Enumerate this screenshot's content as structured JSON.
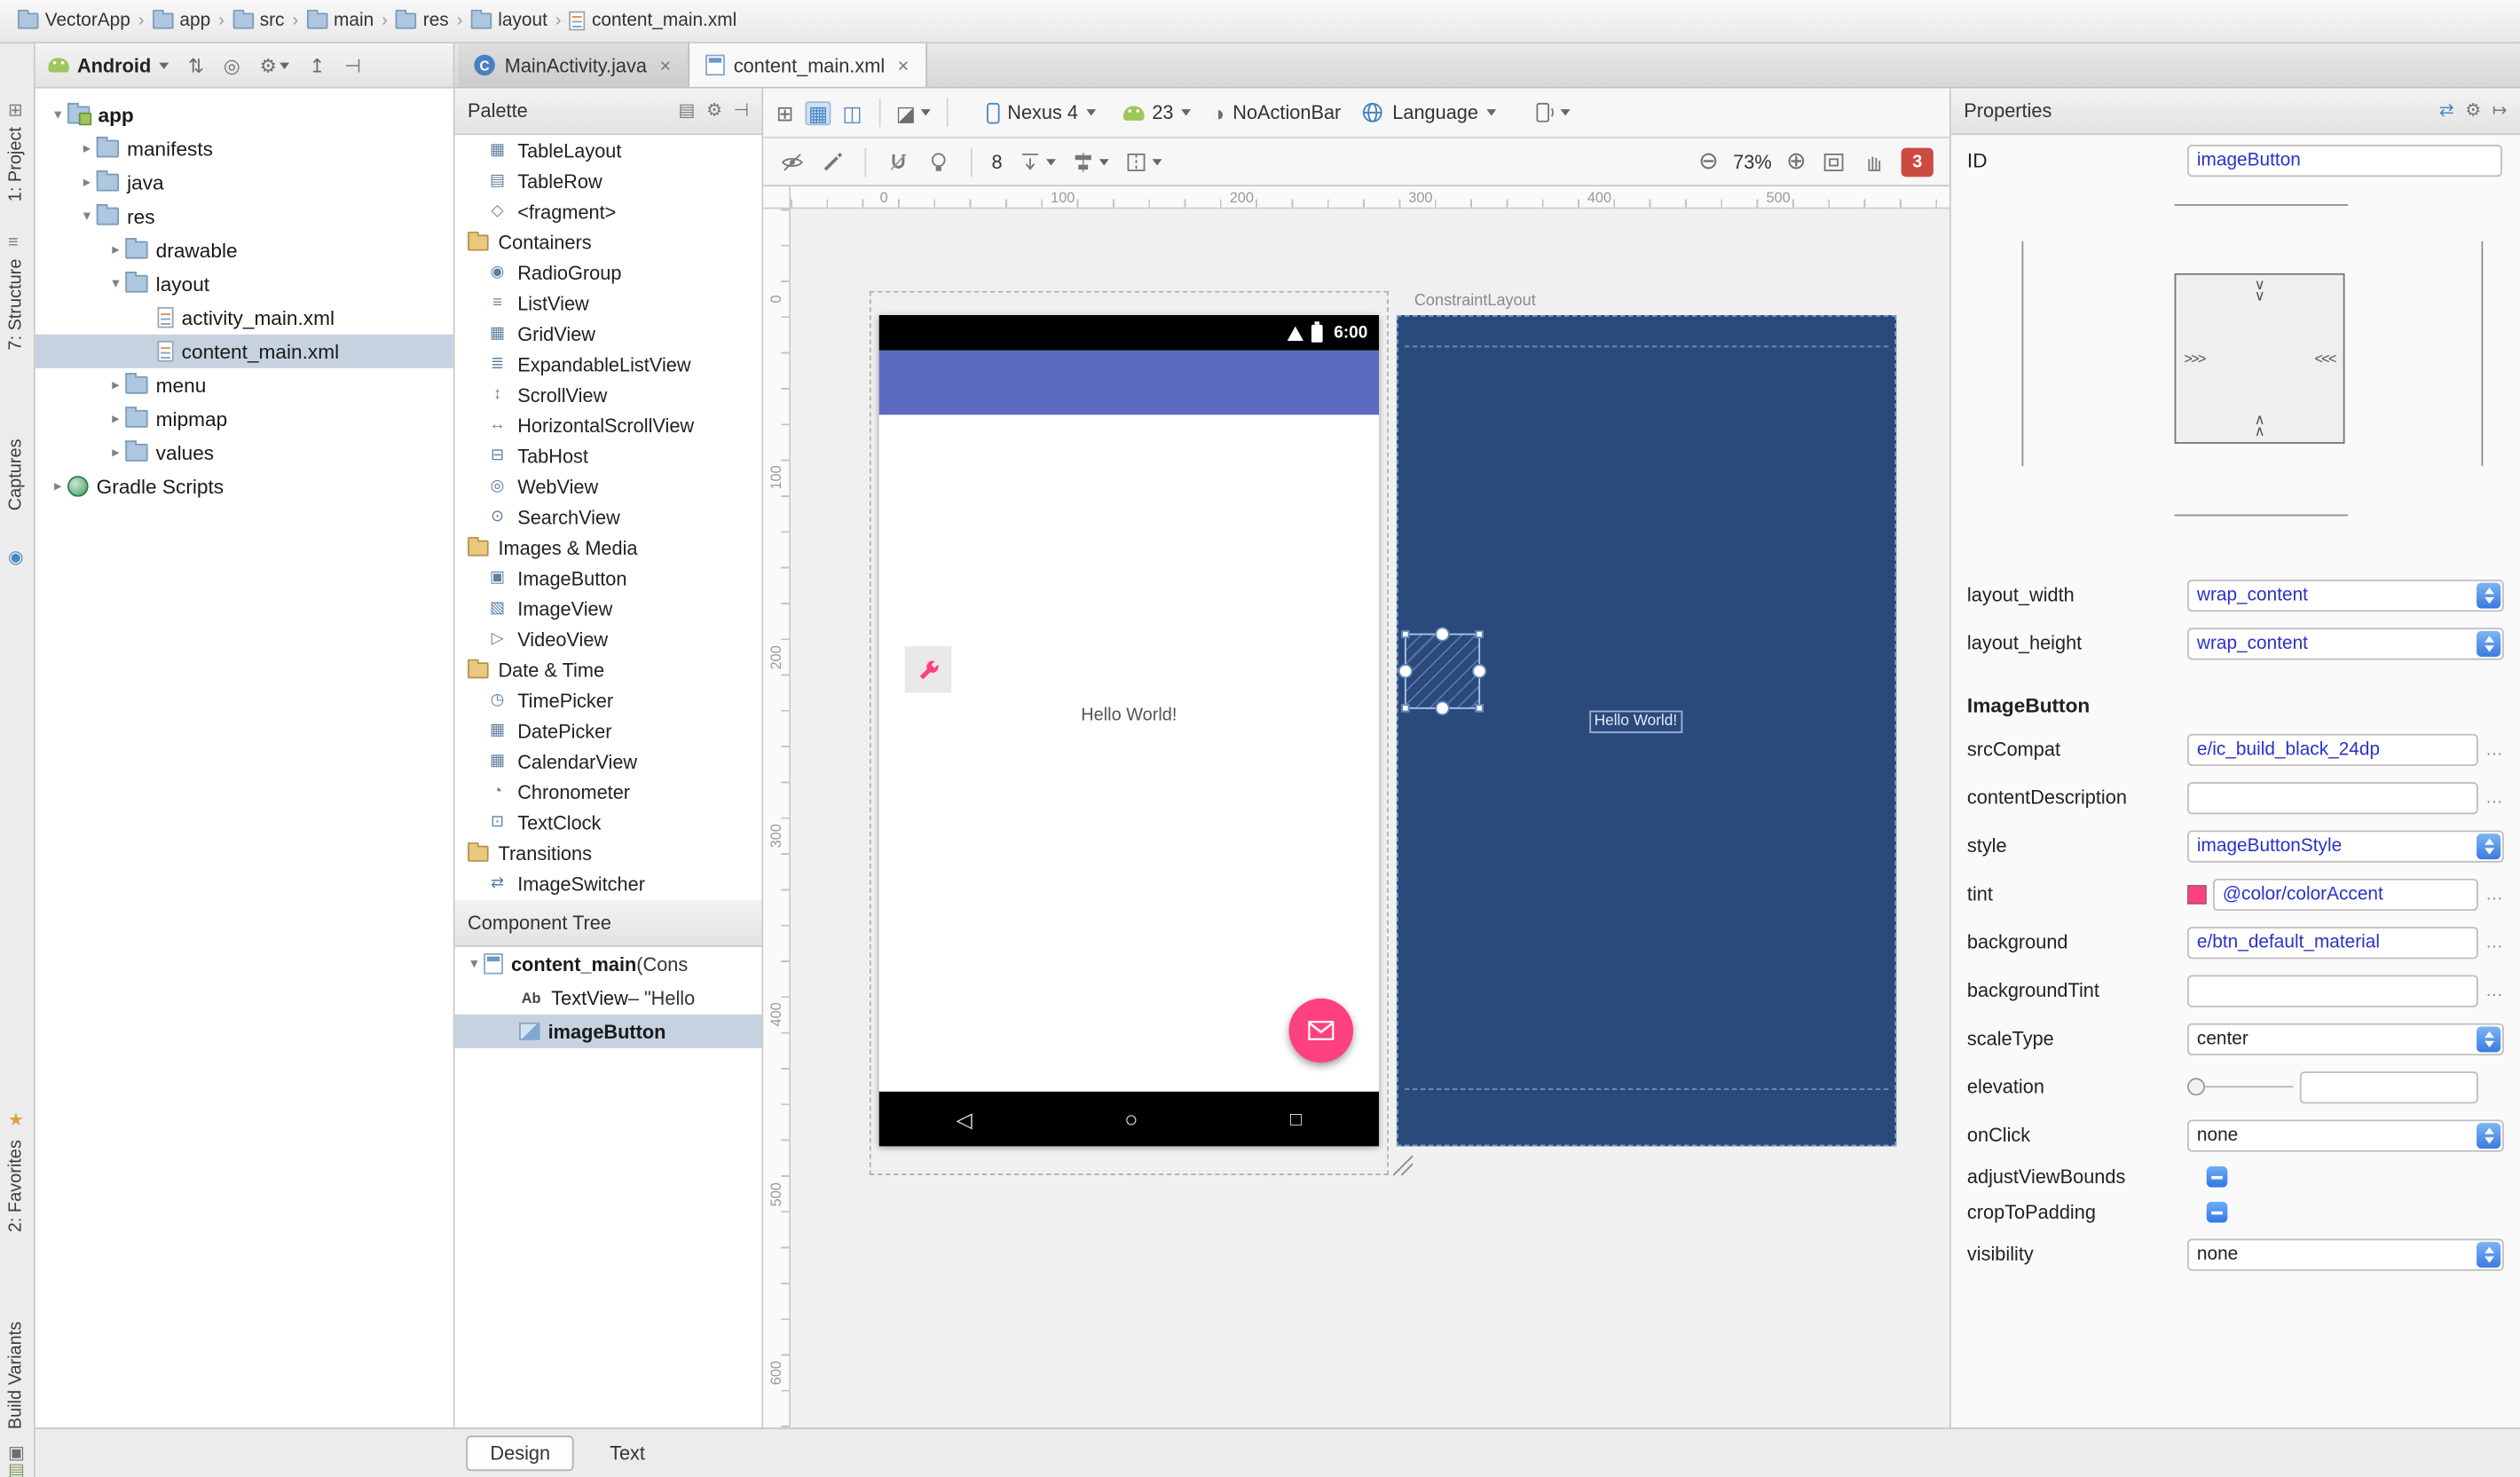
{
  "icons": {
    "crumb_sep": "›",
    "tree_expanded": "▾",
    "tree_collapsed": "▸",
    "close": "×",
    "class_c": "C",
    "ab": "Ab",
    "nav_back": "◁",
    "nav_home": "○",
    "nav_recents": "□",
    "zoom_out": "⊖",
    "zoom_in": "⊕",
    "gear": "⚙",
    "swap": "⇄",
    "pin": "↦",
    "more": "…",
    "grid1": "⊞",
    "grid2": "▦",
    "grid3": "◫",
    "paint": "◪",
    "theme_half": "◑",
    "palette_view": "▤",
    "palette_pin": "⊣",
    "proj_nav": "⇅",
    "proj_locate": "◎",
    "proj_collapse": "↥",
    "proj_pin": "⊣",
    "strip_project": "⊞",
    "strip_structure": "≡",
    "strip_captures": "◉",
    "strip_star": "★",
    "strip_variants": "▤",
    "toggle_toolwindows": "▣"
  },
  "breadcrumb": {
    "items": [
      "VectorApp",
      "app",
      "src",
      "main",
      "res",
      "layout",
      "content_main.xml"
    ]
  },
  "left_strip": {
    "top": [
      {
        "label": "1: Project",
        "icon": "strip_project"
      },
      {
        "label": "7: Structure",
        "icon": "strip_structure"
      },
      {
        "label": "Captures",
        "icon": "strip_captures"
      }
    ],
    "bottom": [
      {
        "label": "2: Favorites",
        "icon": "strip_star"
      },
      {
        "label": "Build Variants",
        "icon": "strip_variants"
      }
    ]
  },
  "project_toolbar": {
    "view": "Android"
  },
  "editor_tabs": [
    {
      "label": "MainActivity.java"
    },
    {
      "label": "content_main.xml"
    }
  ],
  "project_tree": {
    "items": [
      {
        "label": "app",
        "depth": 0,
        "icon": "folder-app",
        "arrow": "down",
        "bold": true
      },
      {
        "label": "manifests",
        "depth": 1,
        "icon": "folder",
        "arrow": "right"
      },
      {
        "label": "java",
        "depth": 1,
        "icon": "folder",
        "arrow": "right"
      },
      {
        "label": "res",
        "depth": 1,
        "icon": "folder-res",
        "arrow": "down"
      },
      {
        "label": "drawable",
        "depth": 2,
        "icon": "folder",
        "arrow": "right"
      },
      {
        "label": "layout",
        "depth": 2,
        "icon": "folder",
        "arrow": "down"
      },
      {
        "label": "activity_main.xml",
        "depth": 3,
        "icon": "file-xml",
        "arrow": "none"
      },
      {
        "label": "content_main.xml",
        "depth": 3,
        "icon": "file-xml",
        "arrow": "none",
        "selected": true
      },
      {
        "label": "menu",
        "depth": 2,
        "icon": "folder",
        "arrow": "right"
      },
      {
        "label": "mipmap",
        "depth": 2,
        "icon": "folder",
        "arrow": "right"
      },
      {
        "label": "values",
        "depth": 2,
        "icon": "folder",
        "arrow": "right"
      },
      {
        "label": "Gradle Scripts",
        "depth": 0,
        "icon": "gradle",
        "arrow": "right"
      }
    ]
  },
  "palette": {
    "title": "Palette",
    "items": [
      {
        "t": "item",
        "label": "TableLayout",
        "g": "▦"
      },
      {
        "t": "item",
        "label": "TableRow",
        "g": "▤"
      },
      {
        "t": "item",
        "label": "<fragment>",
        "g": "◇"
      },
      {
        "t": "header",
        "label": "Containers"
      },
      {
        "t": "item",
        "label": "RadioGroup",
        "g": "◉"
      },
      {
        "t": "item",
        "label": "ListView",
        "g": "≡"
      },
      {
        "t": "item",
        "label": "GridView",
        "g": "▦"
      },
      {
        "t": "item",
        "label": "ExpandableListView",
        "g": "≣"
      },
      {
        "t": "item",
        "label": "ScrollView",
        "g": "↕"
      },
      {
        "t": "item",
        "label": "HorizontalScrollView",
        "g": "↔"
      },
      {
        "t": "item",
        "label": "TabHost",
        "g": "⊟"
      },
      {
        "t": "item",
        "label": "WebView",
        "g": "◎"
      },
      {
        "t": "item",
        "label": "SearchView",
        "g": "⊙"
      },
      {
        "t": "header",
        "label": "Images & Media"
      },
      {
        "t": "item",
        "label": "ImageButton",
        "g": "▣"
      },
      {
        "t": "item",
        "label": "ImageView",
        "g": "▧"
      },
      {
        "t": "item",
        "label": "VideoView",
        "g": "▷"
      },
      {
        "t": "header",
        "label": "Date & Time"
      },
      {
        "t": "item",
        "label": "TimePicker",
        "g": "◷"
      },
      {
        "t": "item",
        "label": "DatePicker",
        "g": "▦"
      },
      {
        "t": "item",
        "label": "CalendarView",
        "g": "▦"
      },
      {
        "t": "item",
        "label": "Chronometer",
        "g": "◔"
      },
      {
        "t": "item",
        "label": "TextClock",
        "g": "⊡"
      },
      {
        "t": "header",
        "label": "Transitions"
      },
      {
        "t": "item",
        "label": "ImageSwitcher",
        "g": "⇄"
      }
    ]
  },
  "component_tree": {
    "title": "Component Tree",
    "items": [
      {
        "name": "content_main",
        "suffix": " (Cons",
        "icon": "layout",
        "selected": false
      },
      {
        "name": "TextView",
        "suffix": " – \"Hello",
        "icon": "ab",
        "selected": false
      },
      {
        "name": "imageButton",
        "suffix": "",
        "icon": "image",
        "selected": true
      }
    ]
  },
  "design_toolbar": {
    "device": "Nexus 4",
    "api": "23",
    "theme": "NoActionBar",
    "language": "Language"
  },
  "zoom_toolbar": {
    "margin": "8",
    "zoom": "73%",
    "errors": "3"
  },
  "canvas": {
    "ruler_top": [
      "0",
      "100",
      "200",
      "300",
      "400",
      "500"
    ],
    "ruler_left": [
      "0",
      "100",
      "200",
      "300",
      "400",
      "500",
      "600"
    ],
    "design": {
      "time": "6:00",
      "hello": "Hello World!"
    },
    "blueprint": {
      "label": "ConstraintLayout",
      "hello": "Hello World!"
    }
  },
  "properties": {
    "title": "Properties",
    "id_label": "ID",
    "id_value": "imageButton",
    "widget": {
      "left": ">>>",
      "right": "<<<",
      "down": "∨",
      "up": "∧"
    },
    "rows": [
      {
        "label": "layout_width",
        "control": "combo",
        "value": "wrap_content",
        "blue": true
      },
      {
        "label": "layout_height",
        "control": "combo",
        "value": "wrap_content",
        "blue": true
      },
      {
        "label": "ImageButton",
        "control": "header"
      },
      {
        "label": "srcCompat",
        "control": "field",
        "value": "e/ic_build_black_24dp",
        "blue": true,
        "more": true
      },
      {
        "label": "contentDescription",
        "control": "field",
        "value": "",
        "more": true
      },
      {
        "label": "style",
        "control": "combo",
        "value": "imageButtonStyle",
        "blue": true
      },
      {
        "label": "tint",
        "control": "field",
        "value": "@color/colorAccent",
        "blue": true,
        "more": true,
        "swatch": "#ff4081"
      },
      {
        "label": "background",
        "control": "field",
        "value": "e/btn_default_material",
        "blue": true,
        "more": true
      },
      {
        "label": "backgroundTint",
        "control": "field",
        "value": "",
        "more": true
      },
      {
        "label": "scaleType",
        "control": "combo",
        "value": "center"
      },
      {
        "label": "elevation",
        "control": "slider",
        "value": ""
      },
      {
        "label": "onClick",
        "control": "combo",
        "value": "none"
      },
      {
        "label": "adjustViewBounds",
        "control": "check"
      },
      {
        "label": "cropToPadding",
        "control": "check"
      },
      {
        "label": "visibility",
        "control": "combo",
        "value": "none"
      }
    ]
  },
  "bottom_bar": {
    "tabs": [
      {
        "label": "Design"
      },
      {
        "label": "Text"
      }
    ]
  }
}
